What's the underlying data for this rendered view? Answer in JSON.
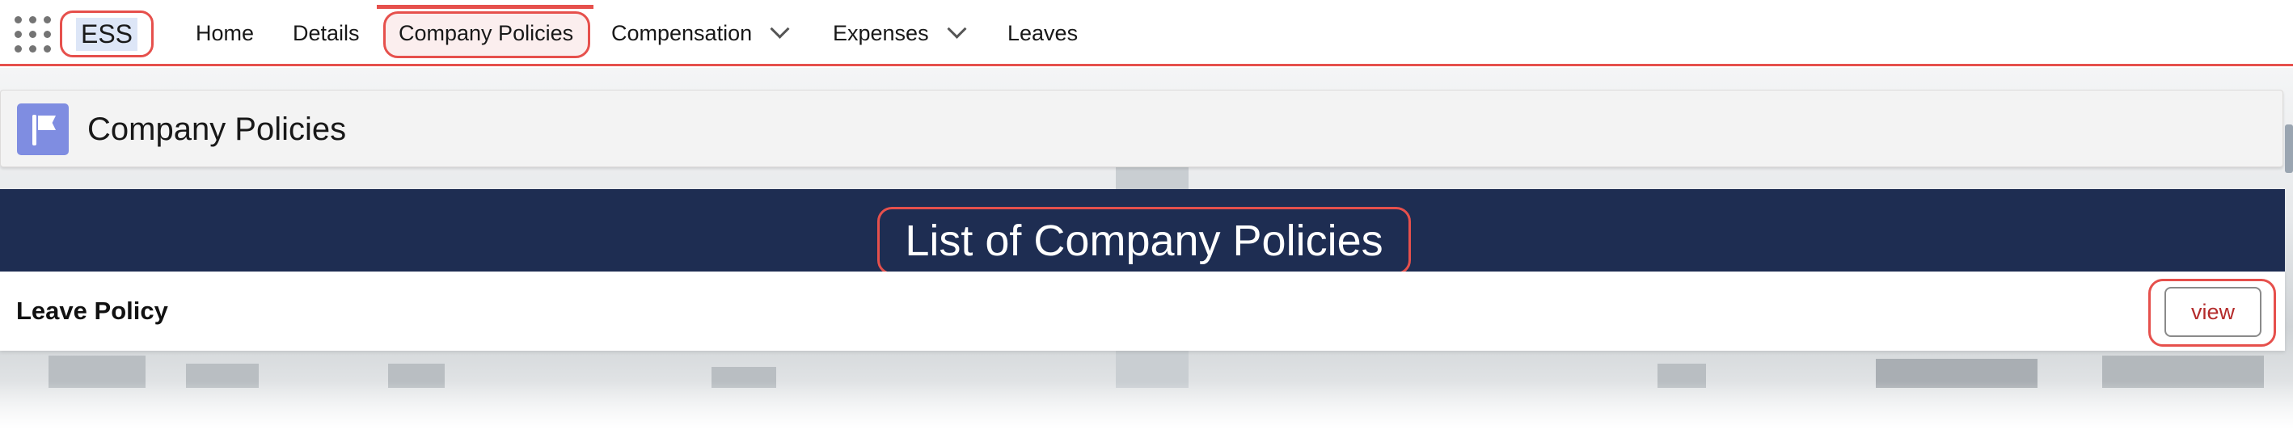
{
  "app": {
    "name": "ESS"
  },
  "nav": {
    "items": [
      {
        "label": "Home",
        "has_dropdown": false
      },
      {
        "label": "Details",
        "has_dropdown": false
      },
      {
        "label": "Company Policies",
        "has_dropdown": false,
        "active": true
      },
      {
        "label": "Compensation",
        "has_dropdown": true
      },
      {
        "label": "Expenses",
        "has_dropdown": true
      },
      {
        "label": "Leaves",
        "has_dropdown": false
      }
    ]
  },
  "page_header": {
    "title": "Company Policies",
    "icon": "flag-icon"
  },
  "banner": {
    "title": "List of Company Policies"
  },
  "policies": [
    {
      "name": "Leave Policy",
      "action_label": "view"
    }
  ],
  "colors": {
    "accent": "#e6504c",
    "banner": "#1e2d52",
    "icon_bg": "#7f8de1",
    "view_text": "#b42b2b"
  }
}
